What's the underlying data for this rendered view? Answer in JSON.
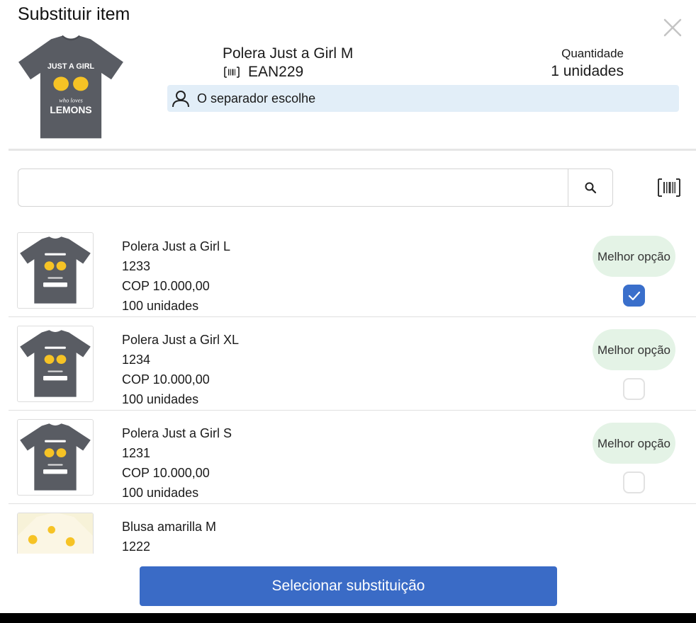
{
  "modal": {
    "title": "Substituir item",
    "product_name": "Polera Just a Girl M",
    "ean": "EAN229",
    "quantity_label": "Quantidade",
    "quantity_value": "1 unidades",
    "picker_text": "O separador escolhe",
    "search": {
      "placeholder": "",
      "value": ""
    },
    "cta_label": "Selecionar substituição",
    "shirt_print": {
      "line1": "JUST A GIRL",
      "line2": "who loves",
      "line3": "LEMONS"
    }
  },
  "items": [
    {
      "name": "Polera Just a Girl L",
      "code": "1233",
      "price": "COP 10.000,00",
      "stock": "100 unidades",
      "badge": "Melhor opção",
      "checked": true,
      "image": "shirt-icon"
    },
    {
      "name": "Polera Just a Girl XL",
      "code": "1234",
      "price": "COP 10.000,00",
      "stock": "100 unidades",
      "badge": "Melhor opção",
      "checked": false,
      "image": "shirt-icon"
    },
    {
      "name": "Polera Just a Girl S",
      "code": "1231",
      "price": "COP 10.000,00",
      "stock": "100 unidades",
      "badge": "Melhor opção",
      "checked": false,
      "image": "shirt-icon"
    },
    {
      "name": "Blusa amarilla M",
      "code": "1222",
      "price": "",
      "stock": "",
      "badge": "",
      "checked": false,
      "image": "blouse-icon"
    }
  ],
  "colors": {
    "accent": "#3a6bc6",
    "badge_bg": "#e4f3e6",
    "info_bg": "#e2eef8",
    "shirt": "#595c63",
    "lemon": "#f6c325"
  }
}
